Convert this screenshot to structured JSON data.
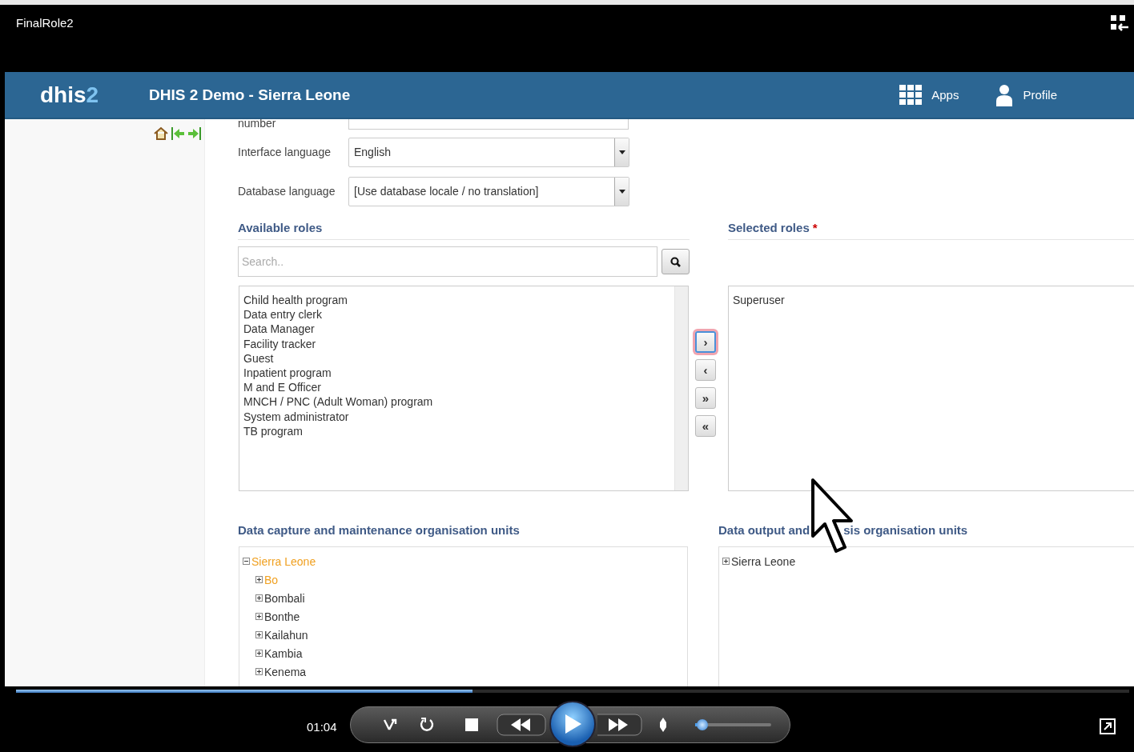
{
  "window": {
    "title": "FinalRole2"
  },
  "header": {
    "logo": "dhis",
    "logo_accent": "2",
    "title": "DHIS 2 Demo - Sierra Leone",
    "links": [
      {
        "label": "Apps"
      },
      {
        "label": "Profile"
      }
    ]
  },
  "form": {
    "fields": [
      {
        "label": "number",
        "kind": "text"
      },
      {
        "label": "Interface language",
        "value": "English",
        "kind": "select"
      },
      {
        "label": "Database language",
        "value": "[Use database locale / no translation]",
        "kind": "select"
      }
    ]
  },
  "roles": {
    "available_title": "Available roles",
    "selected_title": "Selected roles",
    "required_mark": "*",
    "search": {
      "placeholder": "Search.."
    },
    "available": [
      "Child health program",
      "Data entry clerk",
      "Data Manager",
      "Facility tracker",
      "Guest",
      "Inpatient program",
      "M and E Officer",
      "MNCH / PNC (Adult Woman) program",
      "System administrator",
      "TB program"
    ],
    "movers": [
      {
        "symbol": "›",
        "focused": true
      },
      {
        "symbol": "‹",
        "focused": false
      },
      {
        "symbol": "»",
        "focused": false
      },
      {
        "symbol": "«",
        "focused": false
      }
    ],
    "selected": [
      "Superuser"
    ]
  },
  "org_units": {
    "capture_title": "Data capture and maintenance organisation units",
    "capture_tree": [
      {
        "label": "Sierra Leone",
        "expanded": true,
        "selected": true,
        "children": [
          {
            "label": "Bo",
            "expanded": false,
            "selected": true
          },
          {
            "label": "Bombali",
            "expanded": false,
            "selected": false
          },
          {
            "label": "Bonthe",
            "expanded": false,
            "selected": false
          },
          {
            "label": "Kailahun",
            "expanded": false,
            "selected": false
          },
          {
            "label": "Kambia",
            "expanded": false,
            "selected": false
          },
          {
            "label": "Kenema",
            "expanded": false,
            "selected": false
          }
        ]
      }
    ],
    "output_title_parts": [
      "Data output and",
      "sis organisation units"
    ],
    "output_tree": [
      {
        "label": "Sierra Leone",
        "expanded": false,
        "selected": false
      }
    ]
  },
  "player": {
    "time": "01:04",
    "progress": {
      "level": 0.41
    },
    "volume": {
      "level": 0.05
    }
  }
}
